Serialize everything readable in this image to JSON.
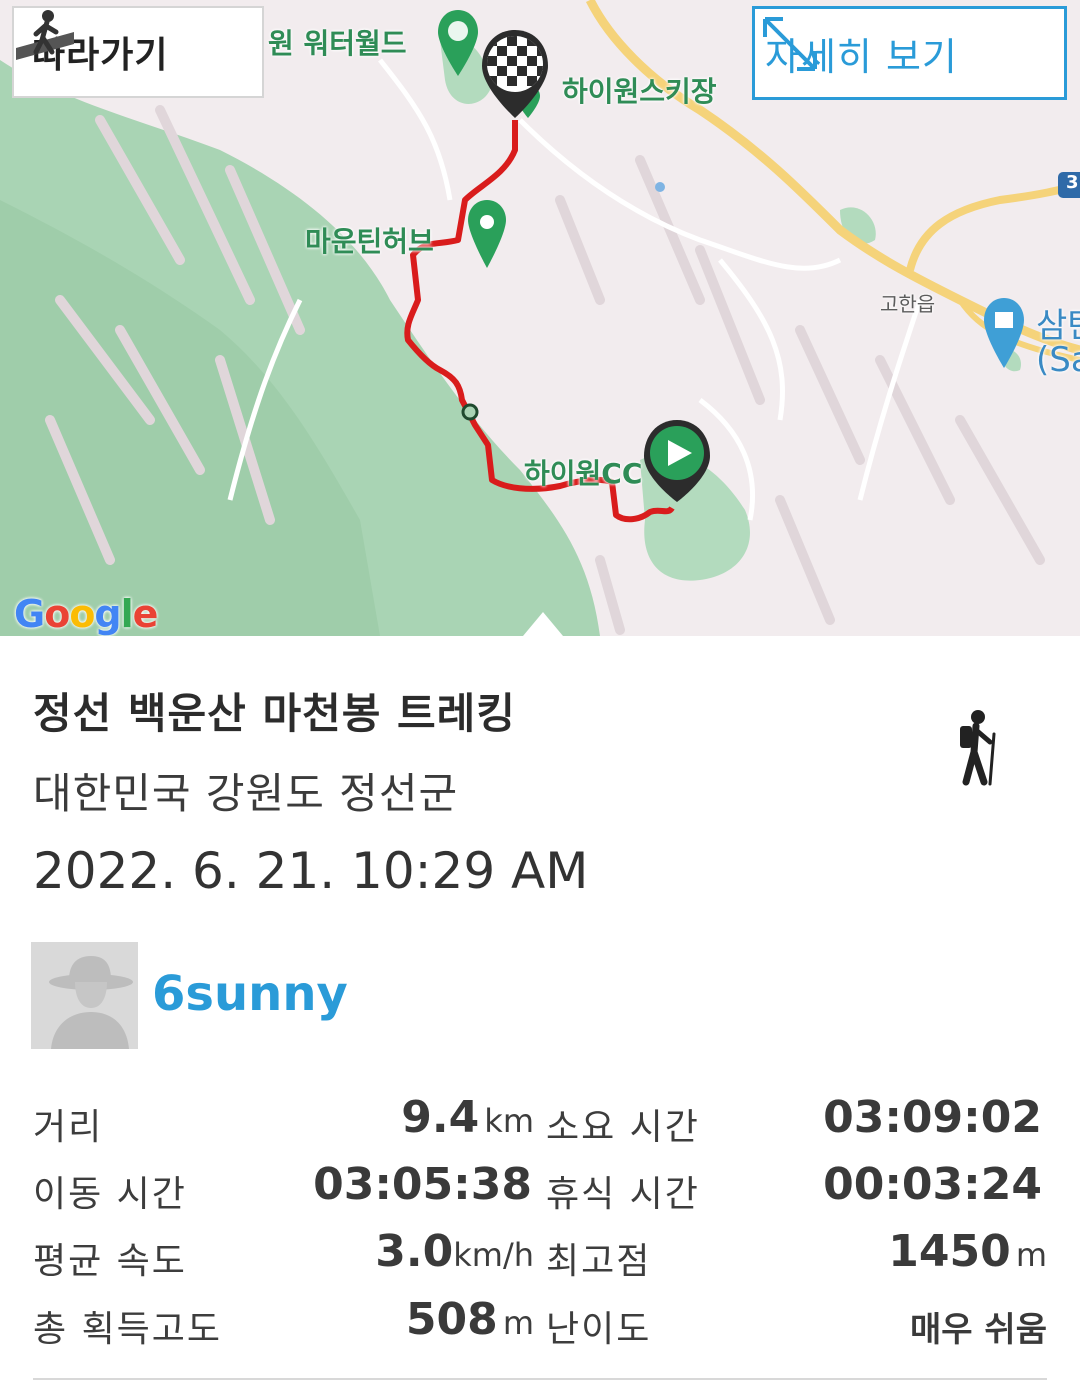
{
  "map": {
    "follow_label": "따라가기",
    "detail_label": "자세히 보기",
    "places": {
      "waterworld": "원 워터월드",
      "ski": "하이원스키장",
      "mountain_hub": "마운틴허브",
      "high1_cc": "하이원CC",
      "gohan": "고한읍",
      "samtan": "삼탄",
      "samtan_sub": "(Sa",
      "road_number": "3"
    },
    "google_logo": "Google",
    "colors": {
      "route": "#d91c1c",
      "accent": "#2a9bd8",
      "forest": "#a9d4b4"
    }
  },
  "track": {
    "title": "정선 백운산 마천봉 트레킹",
    "location": "대한민국 강원도 정선군",
    "datetime": "2022. 6. 21. 10:29 AM",
    "activity_icon": "hiker-icon",
    "user": "6sunny"
  },
  "stats": {
    "distance": {
      "label": "거리",
      "value": "9.4",
      "unit": "km"
    },
    "total_time": {
      "label": "소요 시간",
      "value": "03:09:02"
    },
    "moving_time": {
      "label": "이동 시간",
      "value": "03:05:38"
    },
    "rest_time": {
      "label": "휴식 시간",
      "value": "00:03:24"
    },
    "avg_speed": {
      "label": "평균 속도",
      "value": "3.0",
      "unit": "km/h"
    },
    "max_elevation": {
      "label": "최고점",
      "value": "1450",
      "unit": "m"
    },
    "total_gain": {
      "label": "총 획득고도",
      "value": "508",
      "unit": "m"
    },
    "difficulty": {
      "label": "난이도",
      "value": "매우 쉬움"
    }
  }
}
